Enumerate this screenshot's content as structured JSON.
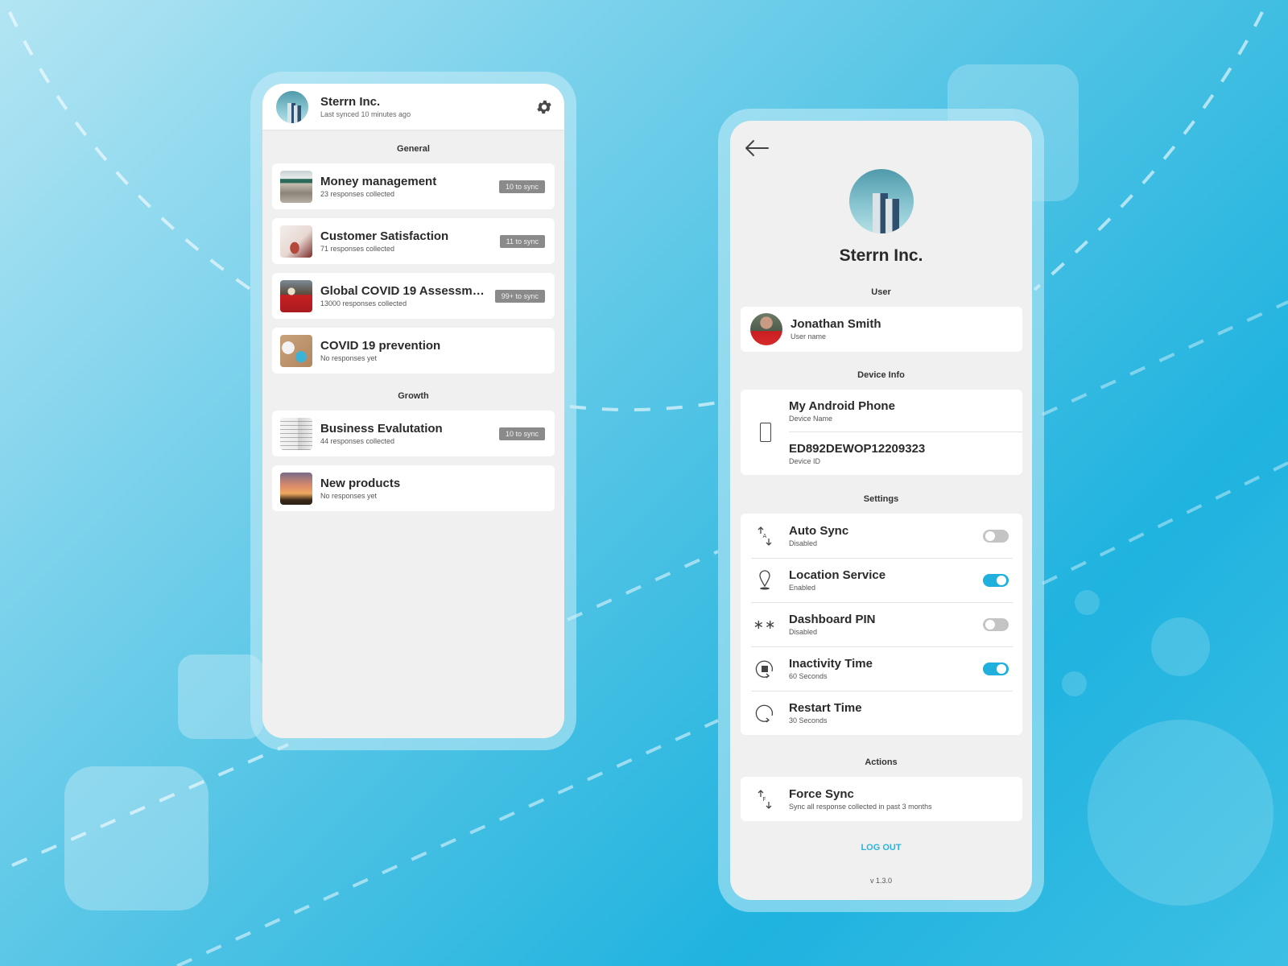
{
  "colors": {
    "accent": "#1fb0dd",
    "badge_bg": "#8a8a8a",
    "screen_bg": "#f0f0f0",
    "toggle_off": "#c4c4c4"
  },
  "left_phone": {
    "header": {
      "title": "Sterrn Inc.",
      "subtitle": "Last synced 10 minutes ago",
      "avatar_icon": "buildings-avatar",
      "settings_icon": "gear-icon"
    },
    "sections": [
      {
        "label": "General",
        "items": [
          {
            "name": "Money management",
            "meta": "23 responses collected",
            "badge": "10 to sync",
            "thumb": "classroom"
          },
          {
            "name": "Customer Satisfaction",
            "meta": "71 responses collected",
            "badge": "11 to sync",
            "thumb": "handshake"
          },
          {
            "name": "Global COVID 19 Assessme...",
            "meta": "13000 responses collected",
            "badge": "99+ to sync",
            "thumb": "masked-person"
          },
          {
            "name": "COVID 19 prevention",
            "meta": "No responses yet",
            "badge": null,
            "thumb": "toilet-paper-mask"
          }
        ]
      },
      {
        "label": "Growth",
        "items": [
          {
            "name": "Business Evalutation",
            "meta": "44 responses collected",
            "badge": "10 to sync",
            "thumb": "papers"
          },
          {
            "name": "New products",
            "meta": "No responses yet",
            "badge": null,
            "thumb": "sunset"
          }
        ]
      }
    ]
  },
  "right_phone": {
    "back_icon": "arrow-left-icon",
    "org_name": "Sterrn Inc.",
    "user_section": {
      "label": "User",
      "name": "Jonathan Smith",
      "sub": "User name"
    },
    "device_section": {
      "label": "Device Info",
      "rows": [
        {
          "value": "My Android Phone",
          "sub": "Device Name"
        },
        {
          "value": "ED892DEWOP12209323",
          "sub": "Device ID"
        }
      ]
    },
    "settings_section": {
      "label": "Settings",
      "rows": [
        {
          "title": "Auto Sync",
          "sub": "Disabled",
          "icon": "auto-sync-icon",
          "toggle": false,
          "has_toggle": true
        },
        {
          "title": "Location Service",
          "sub": "Enabled",
          "icon": "location-pin-icon",
          "toggle": true,
          "has_toggle": true
        },
        {
          "title": "Dashboard PIN",
          "sub": "Disabled",
          "icon": "pin-asterisk-icon",
          "toggle": false,
          "has_toggle": true
        },
        {
          "title": "Inactivity Time",
          "sub": "60 Seconds",
          "icon": "inactivity-timer-icon",
          "toggle": true,
          "has_toggle": true
        },
        {
          "title": "Restart Time",
          "sub": "30 Seconds",
          "icon": "restart-icon",
          "toggle": null,
          "has_toggle": false
        }
      ]
    },
    "actions_section": {
      "label": "Actions",
      "title": "Force Sync",
      "sub": "Sync all response collected in past 3 months",
      "icon": "force-sync-icon"
    },
    "logout_label": "LOG OUT",
    "version": "v 1.3.0"
  }
}
